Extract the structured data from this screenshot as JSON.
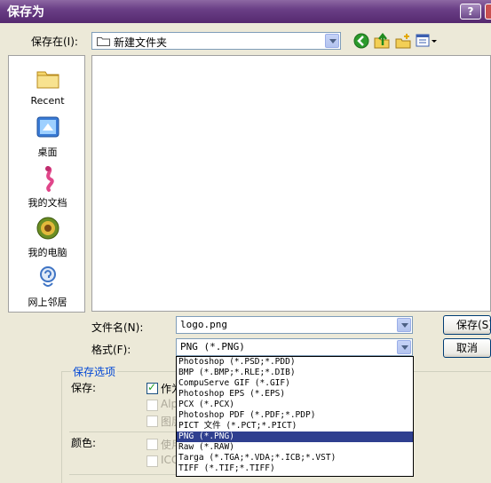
{
  "window": {
    "title": "保存为",
    "help_label": "?"
  },
  "toolbar": {
    "save_in_label": "保存在(I):",
    "folder_name": "新建文件夹",
    "icons": [
      "back-icon",
      "up-folder-icon",
      "new-folder-icon",
      "view-menu-icon"
    ]
  },
  "places": [
    {
      "label": "Recent",
      "icon": "recent-icon"
    },
    {
      "label": "桌面",
      "icon": "desktop-icon"
    },
    {
      "label": "我的文档",
      "icon": "my-documents-icon"
    },
    {
      "label": "我的电脑",
      "icon": "my-computer-icon"
    },
    {
      "label": "网上邻居",
      "icon": "network-icon"
    }
  ],
  "form": {
    "filename_label": "文件名(N):",
    "filename_value": "logo.png",
    "format_label": "格式(F):",
    "format_value": "PNG (*.PNG)",
    "save_button": "保存(S)",
    "cancel_button": "取消"
  },
  "options": {
    "title": "保存选项",
    "save_label": "保存:",
    "as_copy": "作为",
    "alpha": "Alp",
    "layers": "图层",
    "color_label": "颜色:",
    "use_proof": "使用",
    "icc": "ICC"
  },
  "format_options": [
    "Photoshop (*.PSD;*.PDD)",
    "BMP (*.BMP;*.RLE;*.DIB)",
    "CompuServe GIF (*.GIF)",
    "Photoshop EPS (*.EPS)",
    "PCX (*.PCX)",
    "Photoshop PDF (*.PDF;*.PDP)",
    "PICT 文件 (*.PCT;*.PICT)",
    "PNG (*.PNG)",
    "Raw (*.RAW)",
    "Targa (*.TGA;*.VDA;*.ICB;*.VST)",
    "TIFF (*.TIF;*.TIFF)"
  ],
  "selected_format_index": 7,
  "colors": {
    "title_bar": "#6a3f86",
    "highlight": "#2f3f8f",
    "group_title": "#0046d5"
  }
}
